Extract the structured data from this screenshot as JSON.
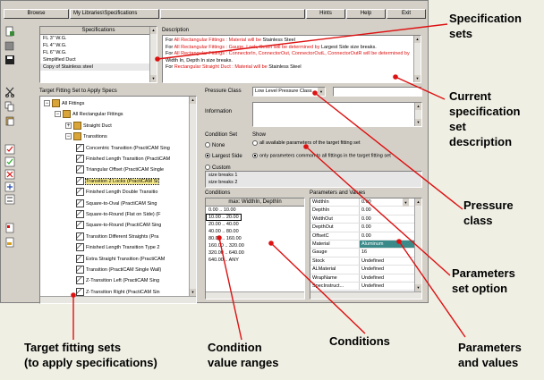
{
  "toolbar": {
    "browse": "Browse",
    "path": "My Libraries\\Specifications",
    "hints": "Hints",
    "help": "Help",
    "exit": "Exit"
  },
  "specs": {
    "header": "Specifications",
    "items": [
      "FL 3\" W.G.",
      "FL 4\" W.G.",
      "FL 6\" W.G.",
      "Simplified Duct",
      "Copy of Stainless steel"
    ]
  },
  "description": {
    "label": "Description",
    "lines": [
      {
        "pre": "For",
        "target": "All Rectangular Fittings",
        "mid": ": Material will be",
        "value": "Stainless Steel"
      },
      {
        "pre": "For",
        "target": "All Rectangular Fittings",
        "mid": ": Gauge, Lock, Seam will be determined by",
        "value": "Largest Side size breaks."
      },
      {
        "pre": "For",
        "target": "All Rectangular Fittings",
        "mid": ": ConnectorIn, ConnectorOut, ConnectorOutL, ConnectorOutR will be determined by",
        "value": "Width In, Depth In size breaks."
      },
      {
        "pre": "For",
        "target": "Rectangular Straight Duct",
        "mid": ": Material will be",
        "value": "Stainless Steel"
      }
    ]
  },
  "tree": {
    "label": "Target Fitting Set to Apply Specs",
    "items": [
      {
        "label": "All Fittings"
      },
      {
        "label": "All Rectangular Fittings"
      },
      {
        "label": "Straight Duct"
      },
      {
        "label": "Transitions"
      },
      {
        "label": "Concentric Transition (PractiCAM Sing"
      },
      {
        "label": "Finished Length Transition (PractiCAM"
      },
      {
        "label": "Triangular Offset (PractiCAM Single"
      },
      {
        "label": "Transition 2 Locks (PractiCAM Si"
      },
      {
        "label": "Finished Length Double Transitio"
      },
      {
        "label": "Square-to-Oval (PractiCAM Sing"
      },
      {
        "label": "Square-to-Round (Flat on Side) (F"
      },
      {
        "label": "Square-to-Round (PractiCAM Sing"
      },
      {
        "label": "Transition Different Straights (Pra"
      },
      {
        "label": "Finished Length Transition Type 2"
      },
      {
        "label": "Extra Straight Transition (PractiCAM"
      },
      {
        "label": "Transition (PractiCAM Single Wall)"
      },
      {
        "label": "Z-Transition Left (PractiCAM Sing"
      },
      {
        "label": "Z-Transition Right (PractiCAM Sin"
      }
    ]
  },
  "pressure": {
    "label": "Pressure Class",
    "value": "Low Level Pressure Class"
  },
  "information": {
    "label": "Information"
  },
  "condition_set": {
    "label": "Condition Set",
    "show_label": "Show",
    "none": "None",
    "largest_side": "Largest Side",
    "custom": "Custom",
    "show_all": "all available parameters of the target fitting set",
    "show_common": "only parameters common to all fittings in the target fitting set"
  },
  "size_breaks": [
    "size breaks 1",
    "size breaks 2"
  ],
  "conditions": {
    "label": "Conditions",
    "header": "max: WidthIn, DepthIn",
    "ranges": [
      "0.00 .. 10.00",
      "10.00 .. 20.00",
      "20.00 .. 40.00",
      "40.00 .. 80.00",
      "80.00 .. 160.00",
      "160.00 .. 320.00",
      "320.00 .. 640.00",
      "640.00 .. ANY"
    ]
  },
  "parameters": {
    "label": "Parameters and Values",
    "rows": [
      {
        "name": "WidthIn",
        "value": "0.00"
      },
      {
        "name": "DepthIn",
        "value": "0.00"
      },
      {
        "name": "WidthOut",
        "value": "0.00"
      },
      {
        "name": "DepthOut",
        "value": "0.00"
      },
      {
        "name": "OffsetC",
        "value": "0.00"
      },
      {
        "name": "Material",
        "value": "Aluminum"
      },
      {
        "name": "Gauge",
        "value": "16"
      },
      {
        "name": "Stock",
        "value": "Undefined"
      },
      {
        "name": "ALMaterial",
        "value": "Undefined"
      },
      {
        "name": "WrapName",
        "value": "Undefined"
      },
      {
        "name": "SpecInstruct...",
        "value": "Undefined"
      }
    ]
  },
  "callouts": {
    "specification_sets": "Specification\nsets",
    "current_description": "Current\nspecification\nset\ndescription",
    "pressure_class": "Pressure\nclass",
    "parameters_set_option": "Parameters\nset option",
    "target_fitting_sets": "Target fitting sets\n(to apply specifications)",
    "condition_value_ranges": "Condition\nvalue ranges",
    "conditions": "Conditions",
    "parameters_and_values": "Parameters\nand values"
  },
  "colors": {
    "accent": "#d11111",
    "selection": "#000080",
    "window": "#d4d0c8",
    "background": "#efefe4"
  }
}
